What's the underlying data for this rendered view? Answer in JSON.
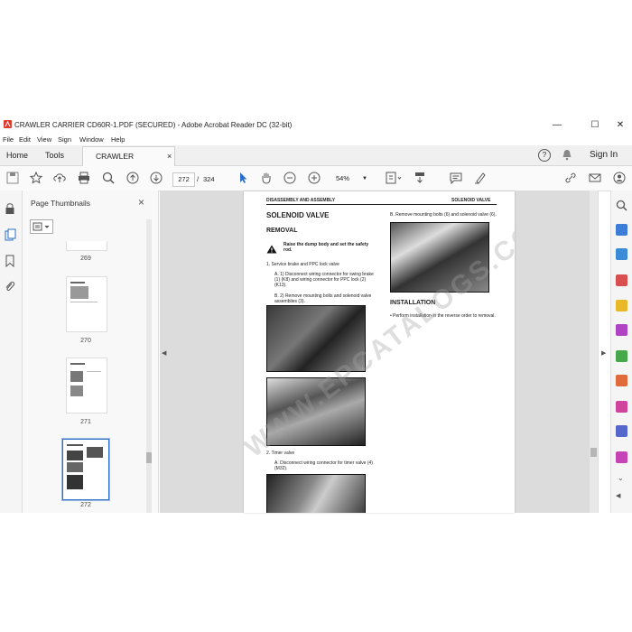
{
  "window": {
    "title": "CRAWLER CARRIER CD60R-1.PDF (SECURED) - Adobe Acrobat Reader DC (32-bit)",
    "minimize": "—",
    "maximize": "☐",
    "close": "✕"
  },
  "menu": [
    "File",
    "Edit",
    "View",
    "Sign",
    "Window",
    "Help"
  ],
  "tabs": {
    "home": "Home",
    "tools": "Tools",
    "doc": "CRAWLER CARRIER...",
    "doc_close": "×",
    "help": "?",
    "sign_in": "Sign In"
  },
  "toolbar": {
    "page_current": "272",
    "page_sep": "/",
    "page_total": "324",
    "zoom": "54%"
  },
  "panel": {
    "title": "Page Thumbnails",
    "close": "×",
    "thumbnails": [
      {
        "label": "269"
      },
      {
        "label": "270"
      },
      {
        "label": "271"
      },
      {
        "label": "272",
        "selected": true
      }
    ]
  },
  "document": {
    "header_left": "DISASSEMBLY AND ASSEMBLY",
    "header_right": "SOLENOID VALVE",
    "title": "SOLENOID VALVE",
    "removal": "REMOVAL",
    "warning": "Raise the dump body and set the safety rod.",
    "step1": "1.   Service brake and PPC lock valve",
    "stepA": "A.  1) Disconnect wiring connector for swing brake (1) (K8) and wiring connector for PPC lock (2) (K13).",
    "stepB": "B.  2) Remove mounting bolts and solenoid valve assemblies (3).",
    "step2": "2.   Timer valve",
    "step2A": "A.  Disconnect wiring connector for timer valve (4) (M32).",
    "right_stepB": "B.  Remove mounting bolts (6) and solenoid valve (6).",
    "installation": "INSTALLATION",
    "install_text": "•   Perform installation in the reverse order to removal.",
    "watermark": "WWW.EPCATALOGS.COM"
  }
}
